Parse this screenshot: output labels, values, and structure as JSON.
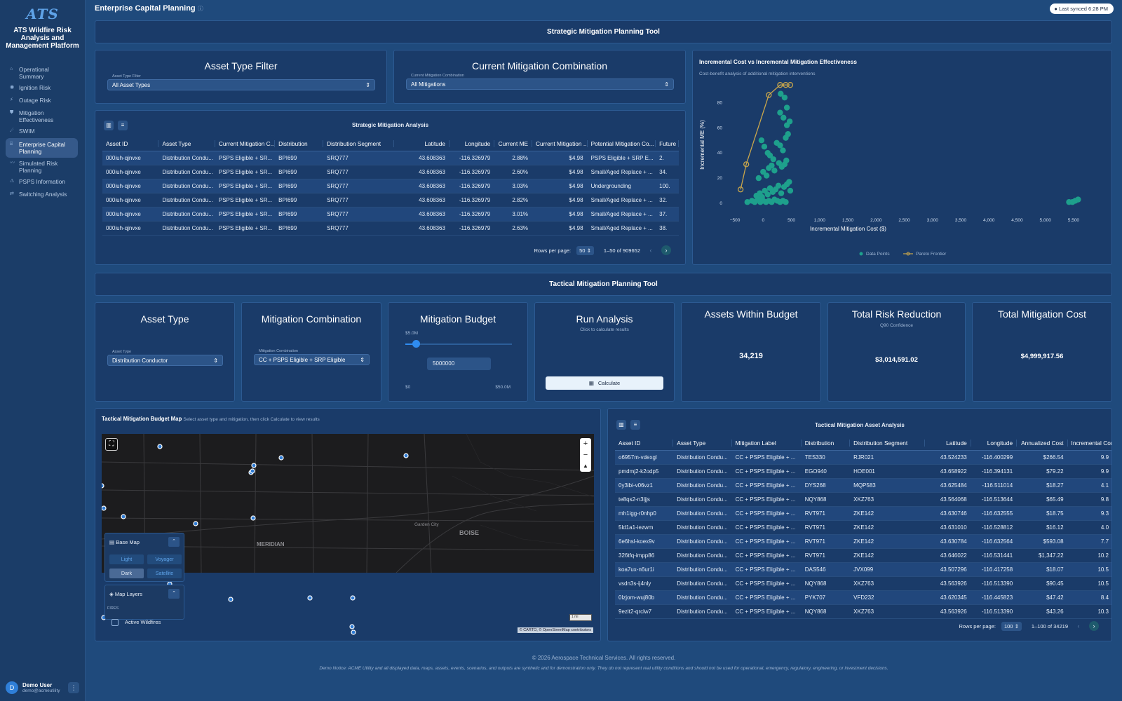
{
  "sidebar": {
    "logo": "ATS",
    "brand": "ATS Wildfire Risk Analysis and Management Platform",
    "items": [
      {
        "label": "Operational Summary"
      },
      {
        "label": "Ignition Risk"
      },
      {
        "label": "Outage Risk"
      },
      {
        "label": "Mitigation Effectiveness"
      },
      {
        "label": "SWIM"
      },
      {
        "label": "Enterprise Capital Planning",
        "active": true
      },
      {
        "label": "Simulated Risk Planning"
      },
      {
        "label": "PSPS Information"
      },
      {
        "label": "Switching Analysis"
      }
    ],
    "user": {
      "initial": "D",
      "name": "Demo User",
      "email": "demo@acmeutility"
    }
  },
  "header": {
    "title": "Enterprise Capital Planning",
    "sync": "Last synced 6:28 PM"
  },
  "strategic": {
    "title": "Strategic Mitigation Planning Tool",
    "asset_filter": {
      "title": "Asset Type Filter",
      "label": "Asset Type Filter",
      "value": "All Asset Types"
    },
    "mitigation": {
      "title": "Current Mitigation Combination",
      "label": "Current Mitigation Combination",
      "value": "All Mitigations"
    },
    "table": {
      "title": "Strategic Mitigation Analysis",
      "columns": [
        "Asset ID",
        "Asset Type",
        "Current Mitigation C...",
        "Distribution",
        "Distribution Segment",
        "Latitude",
        "Longitude",
        "Current ME",
        "Current Mitigation ...",
        "Potential Mitigation Co...",
        "Future"
      ],
      "rows": [
        [
          "000iuh-qjnvxe",
          "Distribution Condu...",
          "PSPS Eligible + SR...",
          "BPI699",
          "SRQ777",
          "43.608363",
          "-116.326979",
          "2.88%",
          "$4.98",
          "PSPS Eligible + SRP E...",
          "2."
        ],
        [
          "000iuh-qjnvxe",
          "Distribution Condu...",
          "PSPS Eligible + SR...",
          "BPI699",
          "SRQ777",
          "43.608363",
          "-116.326979",
          "2.60%",
          "$4.98",
          "Small/Aged Replace + ...",
          "34."
        ],
        [
          "000iuh-qjnvxe",
          "Distribution Condu...",
          "PSPS Eligible + SR...",
          "BPI699",
          "SRQ777",
          "43.608363",
          "-116.326979",
          "3.03%",
          "$4.98",
          "Undergrounding",
          "100."
        ],
        [
          "000iuh-qjnvxe",
          "Distribution Condu...",
          "PSPS Eligible + SR...",
          "BPI699",
          "SRQ777",
          "43.608363",
          "-116.326979",
          "2.82%",
          "$4.98",
          "Small/Aged Replace + ...",
          "32."
        ],
        [
          "000iuh-qjnvxe",
          "Distribution Condu...",
          "PSPS Eligible + SR...",
          "BPI699",
          "SRQ777",
          "43.608363",
          "-116.326979",
          "3.01%",
          "$4.98",
          "Small/Aged Replace + ...",
          "37."
        ],
        [
          "000iuh-qjnvxe",
          "Distribution Condu...",
          "PSPS Eligible + SR...",
          "BPI699",
          "SRQ777",
          "43.608363",
          "-116.326979",
          "2.63%",
          "$4.98",
          "Small/Aged Replace + ...",
          "38."
        ]
      ],
      "rows_per_page_label": "Rows per page:",
      "rows_per_page": "50",
      "range": "1–50 of 909652"
    }
  },
  "chart_data": {
    "type": "scatter",
    "title": "Incremental Cost vs Incremental Mitigation Effectiveness",
    "subtitle": "Cost-benefit analysis of additional mitigation interventions",
    "xlabel": "Incremental Mitigation Cost ($)",
    "ylabel": "Incremental ME (%)",
    "xlim": [
      -650,
      5650
    ],
    "ylim": [
      -5,
      98
    ],
    "xticks": [
      -500,
      0,
      500,
      1000,
      1500,
      2000,
      2500,
      3000,
      3500,
      4000,
      4500,
      5000,
      5500
    ],
    "xtick_labels": [
      "−500",
      "0",
      "500",
      "1,000",
      "1,500",
      "2,000",
      "2,500",
      "3,000",
      "3,500",
      "4,000",
      "4,500",
      "5,000",
      "5,500"
    ],
    "yticks": [
      0,
      20,
      40,
      60,
      80
    ],
    "legend": {
      "position": "bottom",
      "entries": [
        "Data Points",
        "Pareto Frontier"
      ]
    },
    "colors": {
      "points": "#1ea08c",
      "pareto": "#c9a64b"
    },
    "series": [
      {
        "name": "Data Points",
        "points": [
          [
            -280,
            1
          ],
          [
            -200,
            2
          ],
          [
            -150,
            1
          ],
          [
            -100,
            3
          ],
          [
            -50,
            1
          ],
          [
            0,
            2
          ],
          [
            50,
            1
          ],
          [
            100,
            2
          ],
          [
            150,
            1
          ],
          [
            200,
            3
          ],
          [
            250,
            2
          ],
          [
            300,
            1
          ],
          [
            350,
            2
          ],
          [
            400,
            1
          ],
          [
            -120,
            6
          ],
          [
            -60,
            8
          ],
          [
            -20,
            5
          ],
          [
            30,
            10
          ],
          [
            80,
            7
          ],
          [
            120,
            12
          ],
          [
            170,
            9
          ],
          [
            220,
            11
          ],
          [
            270,
            14
          ],
          [
            320,
            8
          ],
          [
            370,
            13
          ],
          [
            420,
            15
          ],
          [
            460,
            17
          ],
          [
            480,
            10
          ],
          [
            -80,
            20
          ],
          [
            0,
            25
          ],
          [
            60,
            22
          ],
          [
            100,
            28
          ],
          [
            150,
            30
          ],
          [
            200,
            26
          ],
          [
            280,
            32
          ],
          [
            330,
            29
          ],
          [
            380,
            31
          ],
          [
            410,
            34
          ],
          [
            -30,
            50
          ],
          [
            20,
            45
          ],
          [
            80,
            40
          ],
          [
            120,
            38
          ],
          [
            180,
            35
          ],
          [
            240,
            48
          ],
          [
            300,
            46
          ],
          [
            350,
            42
          ],
          [
            400,
            52
          ],
          [
            440,
            55
          ],
          [
            300,
            72
          ],
          [
            360,
            68
          ],
          [
            420,
            62
          ],
          [
            470,
            65
          ],
          [
            380,
            84
          ],
          [
            310,
            87
          ],
          [
            420,
            76
          ],
          [
            5420,
            1
          ],
          [
            5480,
            1
          ],
          [
            5530,
            2
          ],
          [
            5580,
            3
          ]
        ]
      },
      {
        "name": "Pareto Frontier",
        "points": [
          [
            -400,
            11
          ],
          [
            -300,
            31
          ],
          [
            100,
            86
          ],
          [
            300,
            94
          ],
          [
            400,
            94
          ],
          [
            480,
            94
          ]
        ]
      }
    ]
  },
  "tactical": {
    "title": "Tactical Mitigation Planning Tool",
    "asset_type": {
      "title": "Asset Type",
      "label": "Asset Type",
      "value": "Distribution Conductor"
    },
    "mitigation": {
      "title": "Mitigation Combination",
      "label": "Mitigation Combination",
      "value": "CC + PSPS Eligible + SRP Eligible"
    },
    "budget": {
      "title": "Mitigation Budget",
      "current": "$5.0M",
      "value": "5000000",
      "min": "$0",
      "max": "$50.0M",
      "fraction": 0.1
    },
    "run": {
      "title": "Run Analysis",
      "hint": "Click to calculate results",
      "button": "Calculate"
    },
    "assets_within": {
      "title": "Assets Within Budget",
      "value": "34,219"
    },
    "risk_reduction": {
      "title": "Total Risk Reduction",
      "sub": "Q90 Confidence",
      "value": "$3,014,591.02"
    },
    "mitigation_cost": {
      "title": "Total Mitigation Cost",
      "value": "$4,999,917.56"
    },
    "map": {
      "title": "Tactical Mitigation Budget Map",
      "subtitle": "Select asset type and mitigation, then click Calculate to view results",
      "base_map": "Base Map",
      "styles": [
        "Light",
        "Voyager",
        "Dark",
        "Satellite"
      ],
      "layers": "Map Layers",
      "fires": "FIRES",
      "active_wildfires": "Active Wildfires",
      "place_meridian": "MERIDIAN",
      "place_garden": "Garden City",
      "place_boise": "BOISE",
      "scale": "1 mi",
      "attribution": "© CARTO, © OpenStreetMap contributors"
    },
    "table": {
      "title": "Tactical Mitigation Asset Analysis",
      "columns": [
        "Asset ID",
        "Asset Type",
        "Mitigation Label",
        "Distribution",
        "Distribution Segment",
        "Latitude",
        "Longitude",
        "Annualized Cost",
        "Incremental Comb"
      ],
      "rows": [
        [
          "o6957m-vdexgl",
          "Distribution Condu...",
          "CC + PSPS Eligible + ...",
          "TES330",
          "RJR021",
          "43.524233",
          "-116.400299",
          "$266.54",
          "9.9"
        ],
        [
          "pmdmj2-k2odp5",
          "Distribution Condu...",
          "CC + PSPS Eligible + ...",
          "EGO940",
          "HOE001",
          "43.658922",
          "-116.394131",
          "$79.22",
          "9.9"
        ],
        [
          "0y3ibi-v06vz1",
          "Distribution Condu...",
          "CC + PSPS Eligible + ...",
          "DYS268",
          "MQP583",
          "43.625484",
          "-116.511014",
          "$18.27",
          "4.1"
        ],
        [
          "te8qs2-n3ljjs",
          "Distribution Condu...",
          "CC + PSPS Eligible + ...",
          "NQY868",
          "XKZ763",
          "43.564068",
          "-116.513644",
          "$65.49",
          "9.8"
        ],
        [
          "mh1igg-r0nhp0",
          "Distribution Condu...",
          "CC + PSPS Eligible + ...",
          "RVT971",
          "ZKE142",
          "43.630746",
          "-116.632555",
          "$18.75",
          "9.3"
        ],
        [
          "5ld1a1-iezwm",
          "Distribution Condu...",
          "CC + PSPS Eligible + ...",
          "RVT971",
          "ZKE142",
          "43.631010",
          "-116.528812",
          "$16.12",
          "4.0"
        ],
        [
          "6e6hsl-koex9v",
          "Distribution Condu...",
          "CC + PSPS Eligible + ...",
          "RVT971",
          "ZKE142",
          "43.630784",
          "-116.632564",
          "$593.08",
          "7.7"
        ],
        [
          "326tfq-impp86",
          "Distribution Condu...",
          "CC + PSPS Eligible + ...",
          "RVT971",
          "ZKE142",
          "43.646022",
          "-116.531441",
          "$1,347.22",
          "10.2"
        ],
        [
          "koa7ux-n6ur1i",
          "Distribution Condu...",
          "CC + PSPS Eligible + ...",
          "DAS546",
          "JVX099",
          "43.507296",
          "-116.417258",
          "$18.07",
          "10.5"
        ],
        [
          "vsdn3s-ij4nly",
          "Distribution Condu...",
          "CC + PSPS Eligible + ...",
          "NQY868",
          "XKZ763",
          "43.563926",
          "-116.513390",
          "$90.45",
          "10.5"
        ],
        [
          "0lzjom-wuj80b",
          "Distribution Condu...",
          "CC + PSPS Eligible + ...",
          "PYK707",
          "VFD232",
          "43.620345",
          "-116.445823",
          "$47.42",
          "8.4"
        ],
        [
          "9ezit2-qrclw7",
          "Distribution Condu...",
          "CC + PSPS Eligible + ...",
          "NQY868",
          "XKZ763",
          "43.563926",
          "-116.513390",
          "$43.26",
          "10.3"
        ]
      ],
      "rows_per_page_label": "Rows per page:",
      "rows_per_page": "100",
      "range": "1–100 of 34219"
    }
  },
  "footer": {
    "copyright": "© 2026 Aerospace Technical Services. All rights reserved.",
    "notice": "Demo Notice: ACME Utility and all displayed data, maps, assets, events, scenarios, and outputs are synthetic and for demonstration only. They do not represent real utility conditions and should not be used for operational, emergency, regulatory, engineering, or investment decisions."
  }
}
